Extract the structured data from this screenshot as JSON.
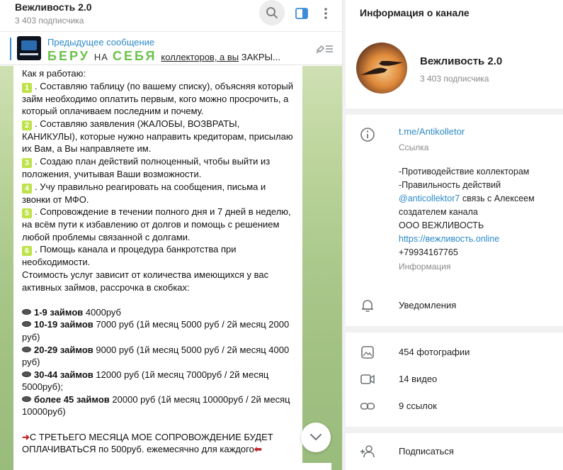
{
  "chat": {
    "title": "Вежливость 2.0",
    "subscribers": "3 403 подписчика"
  },
  "pinned": {
    "title": "Предыдущее сообщение",
    "word1": "БЕРУ",
    "mid": "НА",
    "word2": "СЕБЯ",
    "tail": "коллекторов, а вы",
    "tail2": "ЗАКРЫ..."
  },
  "message": {
    "intro": "Как я работаю:",
    "items": [
      {
        "n": "1",
        "text": ". Составляю таблицу (по вашему списку), объясняя который займ необходимо оплатить первым, кого можно просрочить, а который оплачиваем последним и почему."
      },
      {
        "n": "2",
        "text": ". Составляю заявления (ЖАЛОБЫ, ВОЗВРАТЫ, КАНИКУЛЫ), которые нужно направить кредиторам, присылаю их Вам, а Вы направляете им."
      },
      {
        "n": "3",
        "text": ". Создаю план действий полноценный, чтобы выйти из положения, учитывая Ваши возможности."
      },
      {
        "n": "4",
        "text": ". Учу правильно реагировать на сообщения, письма и звонки от МФО."
      },
      {
        "n": "5",
        "text": ". Сопровождение в течении полного дня и 7 дней в неделю, на всём пути к избавлению от долгов и помощь с решением любой проблемы связанной с долгами."
      },
      {
        "n": "6",
        "text": ". Помощь канала и процедура банкротства при необходимости."
      }
    ],
    "cost": "Стоимость услуг зависит от количества имеющихся у вас активных займов, рассрочка в скобках:",
    "prices": [
      {
        "bold": "1-9 займов",
        "rest": " 4000руб"
      },
      {
        "bold": "10-19 займов",
        "rest": " 7000 руб (1й месяц 5000 руб / 2й месяц 2000 руб)"
      },
      {
        "bold": "20-29 займов",
        "rest": " 9000 руб (1й месяц  5000 руб / 2й месяц 4000 руб)"
      },
      {
        "bold": "30-44 займов",
        "rest": " 12000 руб (1й месяц 7000руб / 2й месяц 5000руб);"
      },
      {
        "bold": "более 45 займов",
        "rest": " 20000 руб (1й месяц 10000руб / 2й месяц 10000руб)"
      }
    ],
    "footer": "С ТРЕТЬЕГО МЕСЯЦА МОЕ СОПРОВОЖДЕНИЕ БУДЕТ ОПЛАЧИВАТЬСЯ по 500руб. ежемесячно для каждого"
  },
  "info": {
    "header": "Информация о канале",
    "name": "Вежливость 2.0",
    "subscribers": "3 403 подписчика",
    "link": "t.me/Antikolletor",
    "link_label": "Ссылка",
    "desc_line1": "-Противодействие коллекторам",
    "desc_line2": "-Правильность действий",
    "desc_mention": "@anticollektor7",
    "desc_line3": " связь с Алексеем создателем канала",
    "desc_line4": "ООО ВЕЖЛИВОСТЬ",
    "desc_site": "https://вежливость.online",
    "desc_phone": "+79934167765",
    "desc_label": "Информация",
    "notifications": "Уведомления",
    "photos": "454 фотографии",
    "videos": "14 видео",
    "links": "9 ссылок",
    "subscribe": "Подписаться"
  },
  "colors": {
    "accent": "#2d8ac7",
    "number_badge": "#bfe24a",
    "arrow": "#c0272d"
  },
  "icons": [
    "search-icon",
    "sidebar-panel-icon",
    "more-vertical-icon",
    "unpin-icon",
    "chevron-down-icon",
    "info-icon",
    "bell-icon",
    "photo-icon",
    "video-icon",
    "link-icon",
    "add-user-icon"
  ]
}
